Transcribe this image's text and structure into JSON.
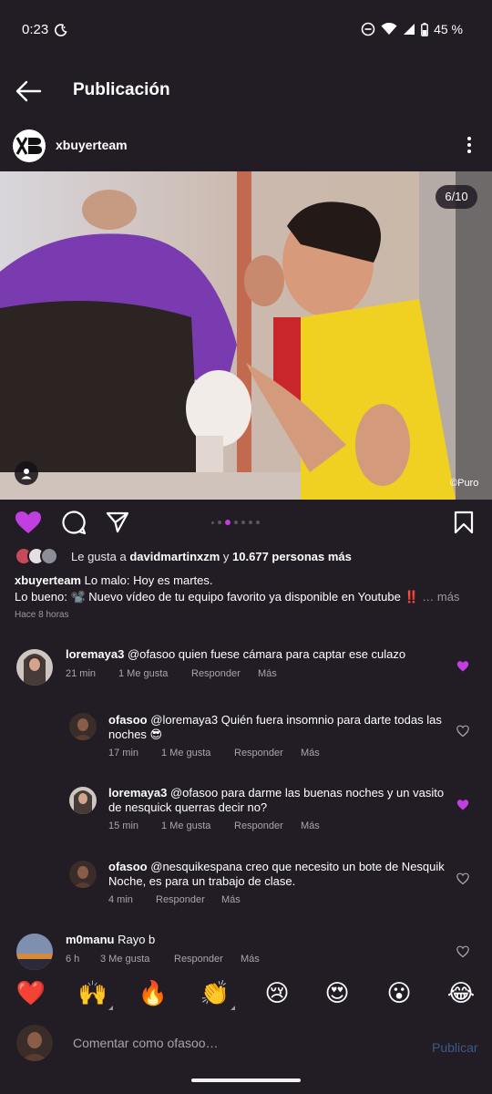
{
  "status_bar": {
    "time": "0:23",
    "battery": "45 %"
  },
  "header": {
    "title": "Publicación"
  },
  "post": {
    "username": "xbuyerteam",
    "photo_counter": "6/10",
    "watermark": "©Puro",
    "carousel": {
      "total_dots": 8,
      "active_index": 3
    },
    "likes": {
      "prefix": "Le gusta a ",
      "user": "davidmartinxzm",
      "middle": " y ",
      "count": "10.677 personas más"
    },
    "caption": {
      "user": "xbuyerteam",
      "line1": "Lo malo: Hoy es martes.",
      "line2": "Lo bueno: 📽️ Nuevo vídeo de tu equipo favorito ya disponible en Youtube ‼️",
      "more": "… más"
    },
    "time_ago": "Hace 8 horas"
  },
  "comments": [
    {
      "user": "loremaya3",
      "text": "@ofasoo quien fuese cámara para captar ese culazo",
      "time": "21 min",
      "likes": "1 Me gusta",
      "reply": "Responder",
      "more": "Más",
      "liked": true
    },
    {
      "user": "ofasoo",
      "text_line1": "@loremaya3 Quién fuera insomnio para darte todas las",
      "text_line2": "noches 😎",
      "time": "17 min",
      "likes": "1 Me gusta",
      "reply": "Responder",
      "more": "Más",
      "liked": false
    },
    {
      "user": "loremaya3",
      "text_line1": "@ofasoo para darme las buenas noches y un vasito",
      "text_line2": "de nesquick querras decir no?",
      "time": "15 min",
      "likes": "1 Me gusta",
      "reply": "Responder",
      "more": "Más",
      "liked": true
    },
    {
      "user": "ofasoo",
      "text_line1": "@nesquikespana creo que necesito un bote de Nesquik",
      "text_line2": "Noche, es para un trabajo de clase.",
      "time": "4 min",
      "reply": "Responder",
      "more": "Más",
      "liked": false
    },
    {
      "user": "m0manu",
      "text": "Rayo b",
      "time": "6 h",
      "likes": "3 Me gusta",
      "reply": "Responder",
      "more": "Más",
      "liked": false
    }
  ],
  "emoji_bar": [
    "❤️",
    "🙌",
    "🔥",
    "👏",
    "😢",
    "😍",
    "😮",
    "😂"
  ],
  "composer": {
    "placeholder": "Comentar como ofasoo…",
    "post_label": "Publicar"
  },
  "colors": {
    "background": "#221c25",
    "like_accent": "#c13fe0",
    "post_button_disabled": "#3f5a86"
  }
}
